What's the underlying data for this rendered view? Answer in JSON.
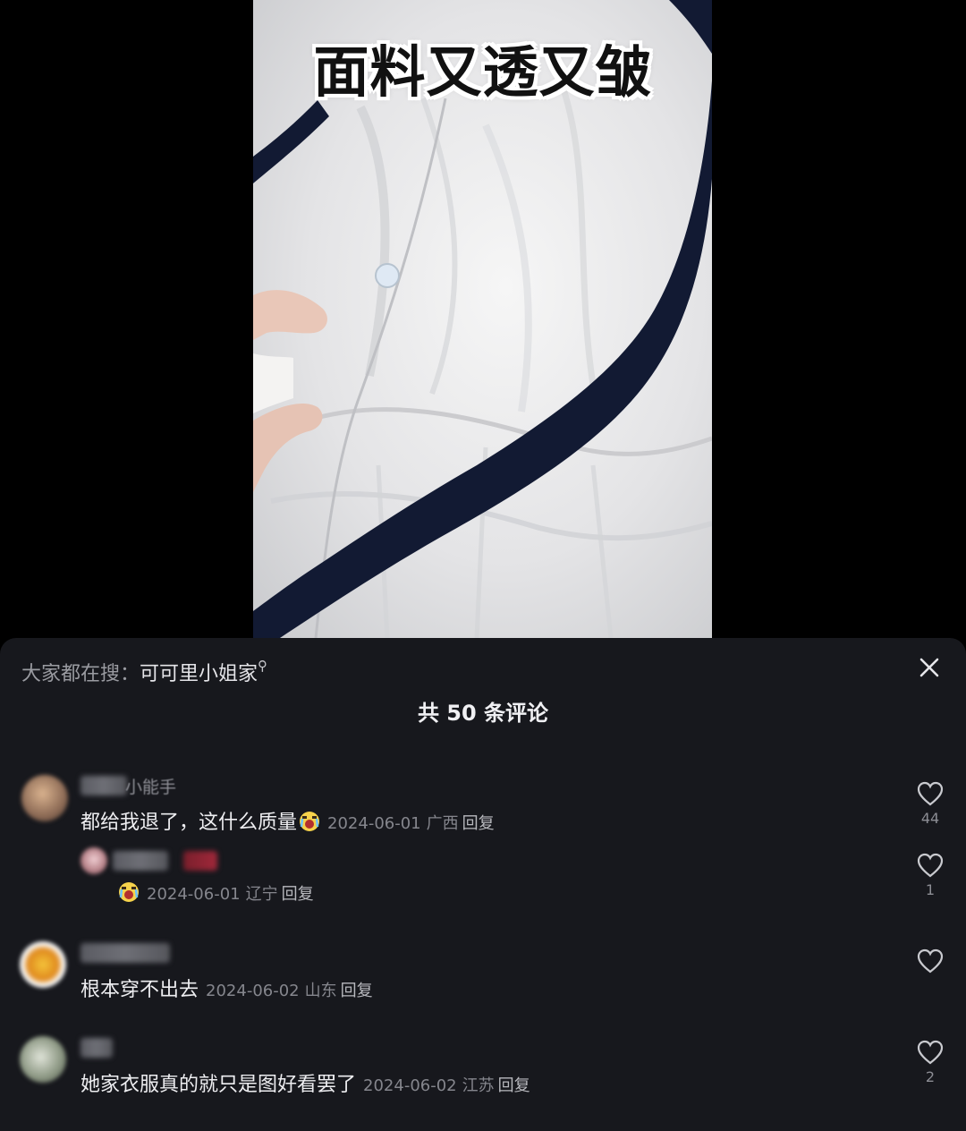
{
  "video": {
    "caption": "面料又透又皱"
  },
  "panel": {
    "search_prefix": "大家都在搜：",
    "search_term": "可可里小姐家",
    "title": "共 50 条评论",
    "reply_label": "回复"
  },
  "comments": [
    {
      "username_partial": "小能手",
      "text": "都给我退了，这什么质量",
      "emoji": "crying-face",
      "date": "2024-06-01",
      "region": "广西",
      "likes": "44"
    },
    {
      "is_reply": true,
      "text": "",
      "emoji": "crying-face",
      "date": "2024-06-01",
      "region": "辽宁",
      "likes": "1"
    },
    {
      "text": "根本穿不出去",
      "date": "2024-06-02",
      "region": "山东",
      "likes": ""
    },
    {
      "text": "她家衣服真的就只是图好看罢了",
      "date": "2024-06-02",
      "region": "江苏",
      "likes": "2"
    }
  ],
  "colors": {
    "panel_bg": "#17181d",
    "meta_text": "#85868d",
    "ribbon": "#121a33"
  }
}
